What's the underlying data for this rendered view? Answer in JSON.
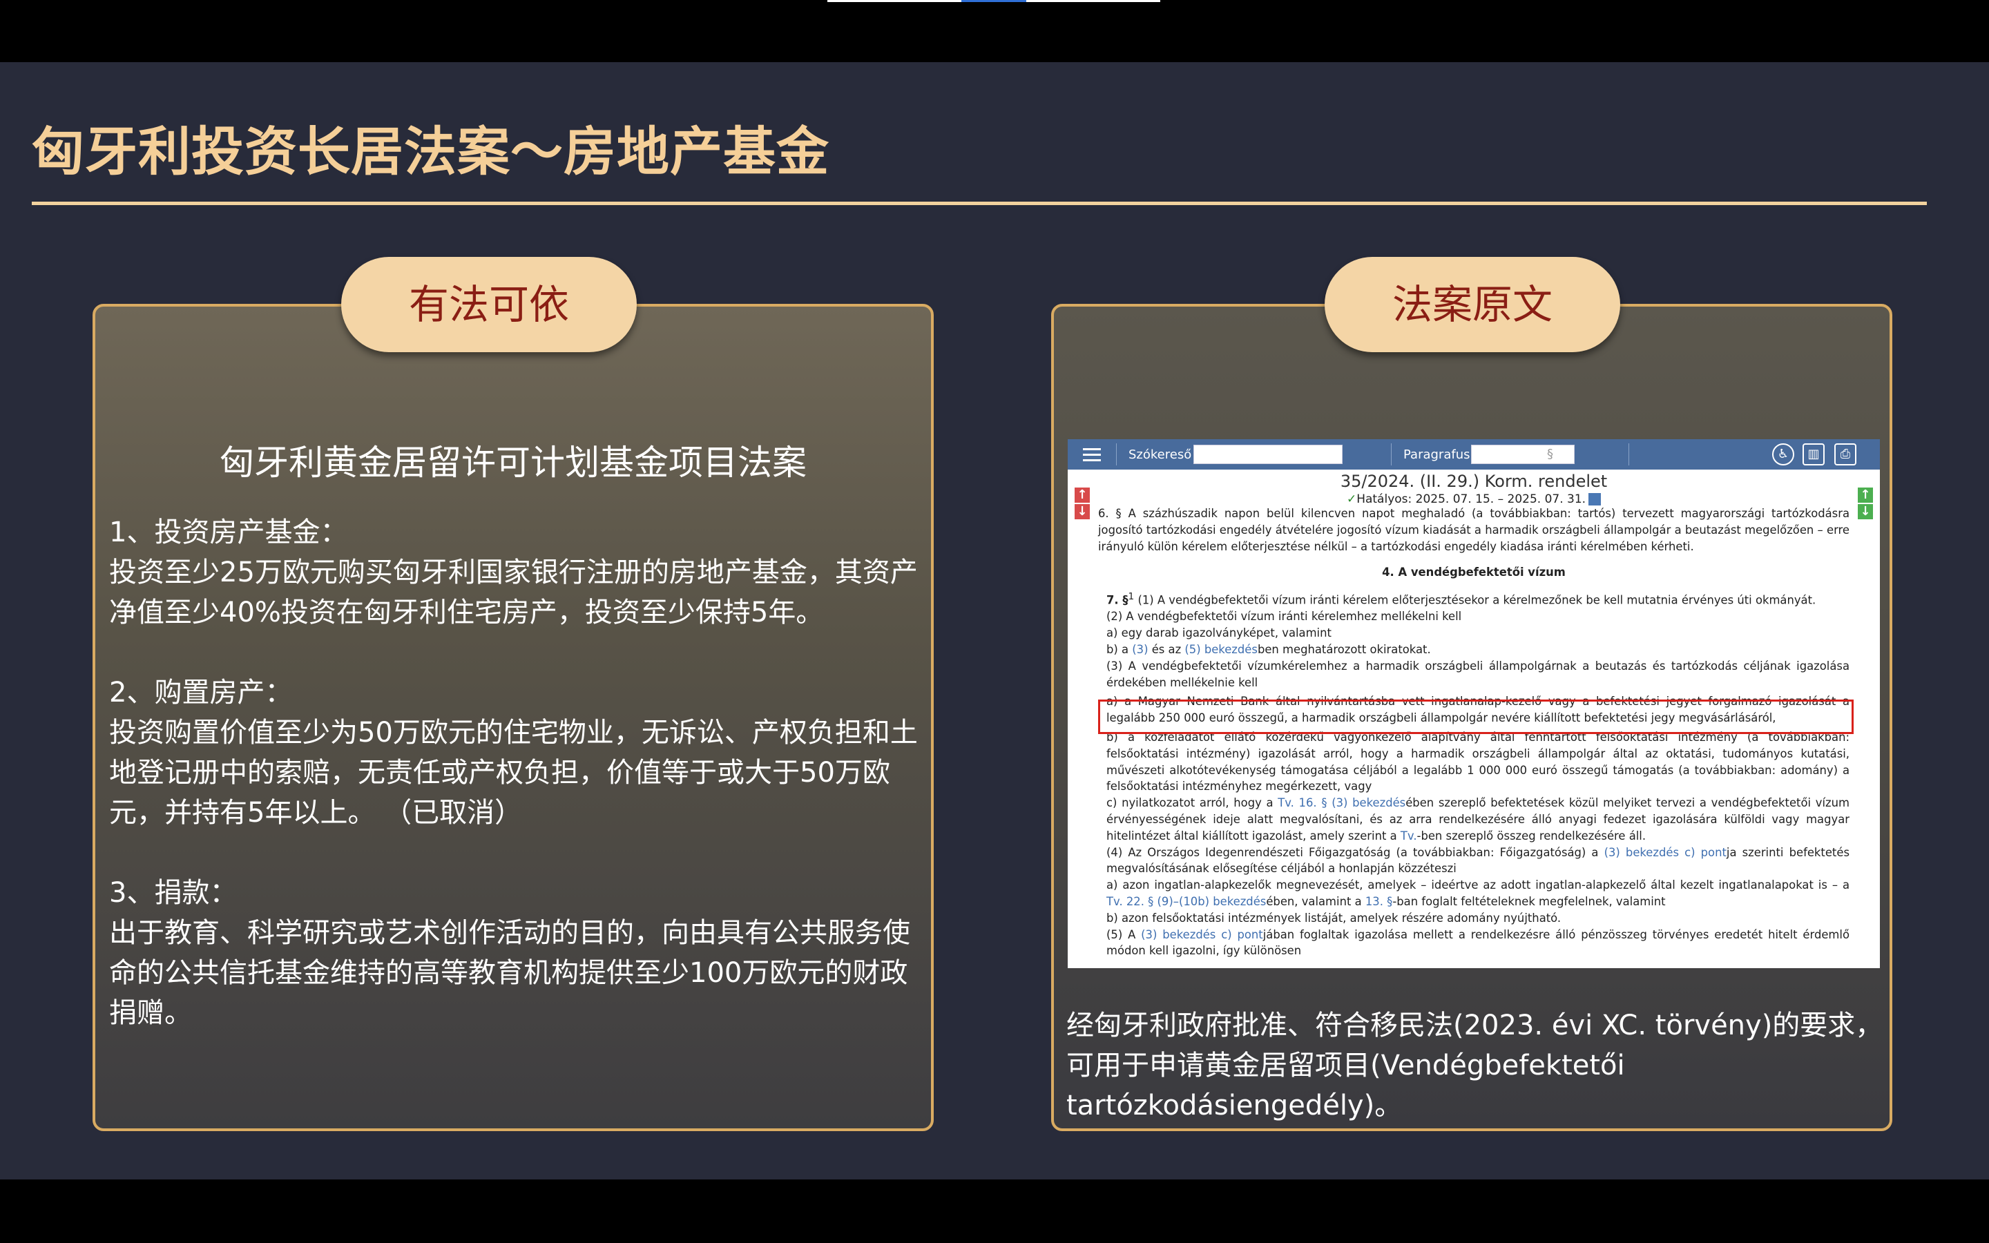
{
  "title": "匈牙利投资长居法案～房地产基金",
  "left_panel": {
    "pill_label": "有法可依",
    "subtitle": "匈牙利黄金居留许可计划基金项目法案",
    "sections": [
      {
        "heading": "1、投资房产基金：",
        "body": "投资至少25万欧元购买匈牙利国家银行注册的房地产基金，其资产净值至少40%投资在匈牙利住宅房产，投资至少保持5年。"
      },
      {
        "heading": "2、购置房产：",
        "body": "投资购置价值至少为50万欧元的住宅物业，无诉讼、产权负担和土地登记册中的索赔，无责任或产权负担，价值等于或大于50万欧元，并持有5年以上。 （已取消）"
      },
      {
        "heading": "3、捐款：",
        "body": "出于教育、科学研究或艺术创作活动的目的，向由具有公共服务使命的公共信托基金维持的高等教育机构提供至少100万欧元的财政捐赠。"
      }
    ]
  },
  "right_panel": {
    "pill_label": "法案原文",
    "caption": "经匈牙利政府批准、符合移民法(2023. évi XC. törvény)的要求，可用于申请黄金居留项目(Vendégbefektetői tartózkodásiengedély)。",
    "document": {
      "toolbar": {
        "search_label": "Szókereső",
        "search_value": "",
        "paragraph_label": "Paragrafus",
        "paragraph_symbol": "§",
        "icons": [
          "accessibility-icon",
          "layout-icon",
          "print-icon"
        ]
      },
      "heading": "35/2024. (II. 29.) Korm. rendelet",
      "validity": "Hatályos: 2025. 07. 15. – 2025. 07. 31.",
      "intro": "6. § A százhúszadik napon belül kilencven napot meghaladó (a továbbiakban: tartós) tervezett magyarországi tartózkodásra jogosító tartózkodási engedély átvételére jogosító vízum kiadását a harmadik országbeli állampolgár a beutazást megelőzően – erre irányuló külön kérelem előterjesztése nélkül – a tartózkodási engedély kiadása iránti kérelmében kérheti.",
      "section_title": "4. A vendégbefektetői vízum",
      "para_num": "7. §",
      "para_sup": "1",
      "p1": " (1) A vendégbefektetői vízum iránti kérelem előterjesztésekor a kérelmezőnek be kell mutatnia érvényes úti okmányát.",
      "p2": "(2) A vendégbefektetői vízum iránti kérelemhez mellékelni kell",
      "p2a": "a) egy darab igazolványképet, valamint",
      "p2b_pre": "b) a ",
      "p2b_l1": "(3)",
      "p2b_mid": " és az ",
      "p2b_l2": "(5) bekezdés",
      "p2b_post": "ben meghatározott okiratokat.",
      "p3": "(3) A vendégbefektetői vízumkérelemhez a harmadik országbeli állampolgárnak a beutazás és tartózkodás céljának igazolása érdekében mellékelnie kell",
      "p3a": "a) a Magyar Nemzeti Bank által nyilvántartásba vett ingatlanalap-kezelő vagy a befektetési jegyet forgalmazó igazolását a legalább 250 000 euró összegű, a harmadik országbeli állampolgár nevére kiállított befektetési jegy megvásárlásáról,",
      "p3b": "b) a közfeladatot ellátó közérdekű vagyonkezelő alapítvány által fenntartott felsőoktatási intézmény (a továbbiakban: felsőoktatási intézmény) igazolását arról, hogy a harmadik országbeli állampolgár által az oktatási, tudományos kutatási, művészeti alkotótevékenység támogatása céljából a legalább 1 000 000 euró összegű támogatás (a továbbiakban: adomány) a felsőoktatási intézményhez megérkezett, vagy",
      "p3c_pre": "c) nyilatkozatot arról, hogy a ",
      "p3c_l1": "Tv. 16. § (3) bekezdés",
      "p3c_mid": "ében szereplő befektetések közül melyiket tervezi a vendégbefektetői vízum érvényességének ideje alatt megvalósítani, és az arra rendelkezésére álló anyagi fedezet igazolására külföldi vagy magyar hitelintézet által kiállított igazolást, amely szerint a ",
      "p3c_l2": "Tv.",
      "p3c_post": "-ben szereplő összeg rendelkezésére áll.",
      "p4_pre": "(4) Az Országos Idegenrendészeti Főigazgatóság (a továbbiakban: Főigazgatóság) a ",
      "p4_l1": "(3) bekezdés c) pont",
      "p4_post": "ja szerinti befektetés megvalósításának elősegítése céljából a honlapján közzéteszi",
      "p4a_pre": "a) azon ingatlan-alapkezelők megnevezését, amelyek – ideértve az adott ingatlan-alapkezelő által kezelt ingatlanalapokat is – a ",
      "p4a_l1": "Tv. 22. § (9)–(10b) bekezdés",
      "p4a_mid": "ében, valamint a ",
      "p4a_l2": "13. §",
      "p4a_post": "-ban foglalt feltételeknek megfelelnek, valamint",
      "p4b": "b) azon felsőoktatási intézmények listáját, amelyek részére adomány nyújtható.",
      "p5_pre": "(5) A ",
      "p5_l1": "(3) bekezdés c) pont",
      "p5_post": "jában foglaltak igazolása mellett a rendelkezésre álló pénzösszeg törvényes eredetét hitelt érdemlő módon kell igazolni, így különösen"
    }
  },
  "colors": {
    "background": "#282b3a",
    "title": "#f5cf98",
    "pill": "#f4d5a6",
    "pill_text": "#8a1e14",
    "panel_border": "#d9ab62",
    "highlight_box": "#d9221b"
  }
}
